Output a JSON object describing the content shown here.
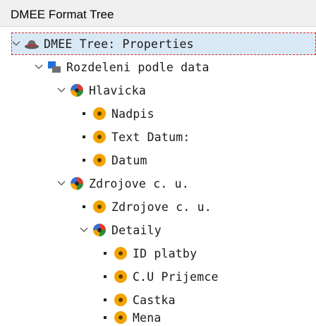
{
  "header": {
    "title": "DMEE Format Tree"
  },
  "nodes": [
    {
      "label": "DMEE Tree: Properties",
      "icon": "hat-icon",
      "expanded": true,
      "selected": true
    },
    {
      "label": "Rozdeleni podle data",
      "icon": "segment-icon",
      "expanded": true
    },
    {
      "label": "Hlavicka",
      "icon": "multicolor-ball-icon",
      "expanded": true
    },
    {
      "label": "Nadpis",
      "icon": "orange-circle-icon",
      "leaf": true
    },
    {
      "label": "Text Datum:",
      "icon": "orange-circle-icon",
      "leaf": true
    },
    {
      "label": "Datum",
      "icon": "orange-circle-icon",
      "leaf": true
    },
    {
      "label": "Zdrojove c. u.",
      "icon": "multicolor-ball-icon",
      "expanded": true
    },
    {
      "label": "Zdrojove c. u.",
      "icon": "orange-circle-icon",
      "leaf": true
    },
    {
      "label": "Detaily",
      "icon": "multicolor-ball-icon",
      "expanded": true
    },
    {
      "label": "ID platby",
      "icon": "orange-circle-icon",
      "leaf": true
    },
    {
      "label": "C.U Prijemce",
      "icon": "orange-circle-icon",
      "leaf": true
    },
    {
      "label": "Castka",
      "icon": "orange-circle-icon",
      "leaf": true
    },
    {
      "label": "Mena",
      "icon": "orange-circle-icon",
      "leaf": true
    }
  ],
  "colors": {
    "selection_bg": "#d9e8f5",
    "selection_border": "#d22a2a",
    "leaf_icon": "#f2a300"
  }
}
